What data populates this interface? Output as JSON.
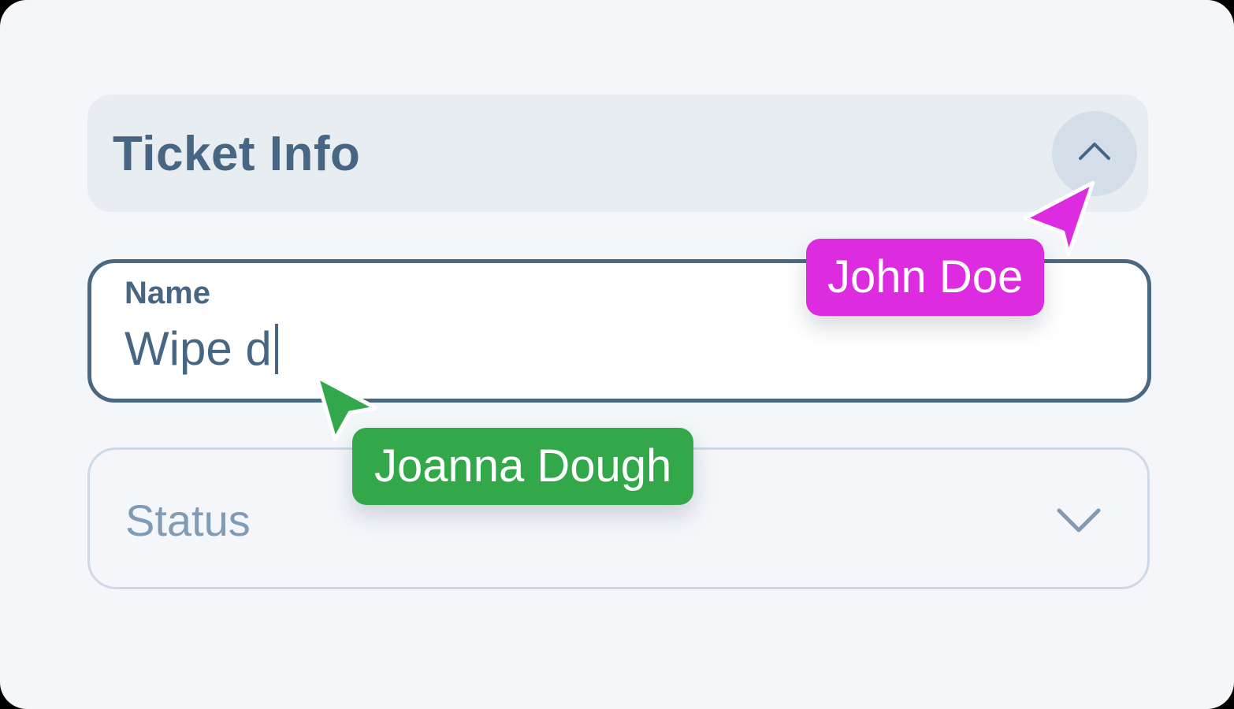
{
  "section": {
    "title": "Ticket Info",
    "toggle_icon": "chevron-up-icon"
  },
  "form": {
    "name": {
      "label": "Name",
      "value": "Wipe d"
    },
    "status": {
      "placeholder": "Status",
      "icon": "chevron-down-icon"
    }
  },
  "collaborators": [
    {
      "name": "John Doe",
      "color": "#dd2ce0"
    },
    {
      "name": "Joanna Dough",
      "color": "#33a84a"
    }
  ],
  "colors": {
    "background": "#f4f6fa",
    "header_bg": "#e8edf2",
    "text": "#476683",
    "placeholder": "#7f9bb5",
    "focused_border": "#4b6882",
    "idle_border": "#cdd9e5"
  }
}
